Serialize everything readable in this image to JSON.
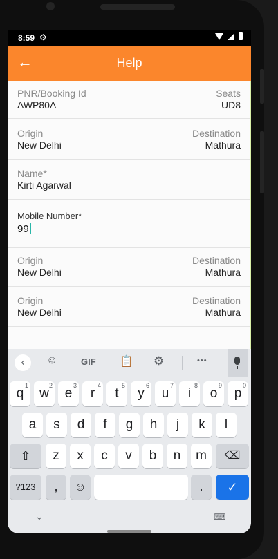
{
  "statusbar": {
    "time": "8:59"
  },
  "appbar": {
    "title": "Help"
  },
  "form": {
    "pnr_label": "PNR/Booking Id",
    "pnr_value": "AWP80A",
    "seats_label": "Seats",
    "seats_value": "UD8",
    "origin_label": "Origin",
    "origin_value": "New Delhi",
    "destination_label": "Destination",
    "destination_value": "Mathura",
    "name_label": "Name*",
    "name_value": "Kirti Agarwal",
    "mobile_label": "Mobile Number*",
    "mobile_value": "99",
    "rows": [
      {
        "origin_label": "Origin",
        "origin_value": "New Delhi",
        "destination_label": "Destination",
        "destination_value": "Mathura"
      },
      {
        "origin_label": "Origin",
        "origin_value": "New Delhi",
        "destination_label": "Destination",
        "destination_value": "Mathura"
      }
    ]
  },
  "keyboard": {
    "toolbar": {
      "gif": "GIF",
      "more": "•••"
    },
    "row1": [
      "q",
      "w",
      "e",
      "r",
      "t",
      "y",
      "u",
      "i",
      "o",
      "p"
    ],
    "row1_hints": [
      "1",
      "2",
      "3",
      "4",
      "5",
      "6",
      "7",
      "8",
      "9",
      "0"
    ],
    "row2": [
      "a",
      "s",
      "d",
      "f",
      "g",
      "h",
      "j",
      "k",
      "l"
    ],
    "row3": [
      "z",
      "x",
      "c",
      "v",
      "b",
      "n",
      "m"
    ],
    "symbols": "?123",
    "comma": ",",
    "period": "."
  }
}
